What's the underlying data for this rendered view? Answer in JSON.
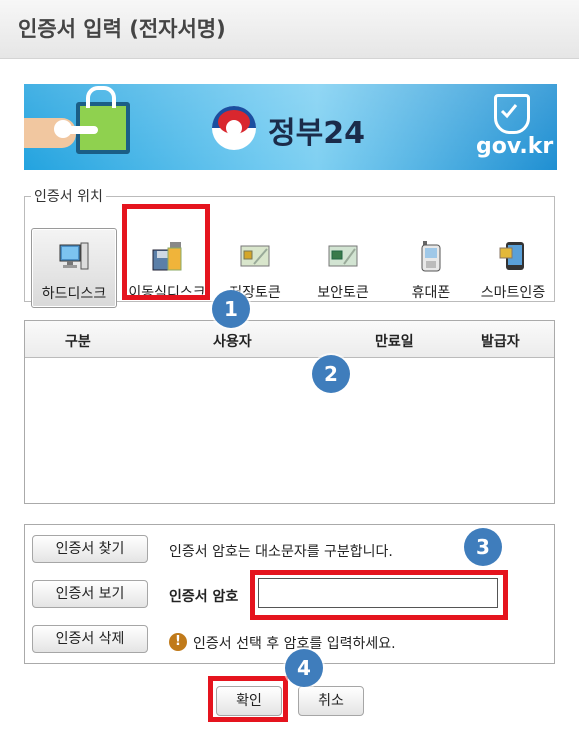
{
  "window": {
    "title": "인증서 입력 (전자서명)"
  },
  "banner": {
    "gov_name": "정부24",
    "domain": "gov.kr"
  },
  "location": {
    "legend": "인증서 위치",
    "devices": [
      {
        "label": "하드디스크",
        "icon": "hard-disk-icon",
        "selected": true
      },
      {
        "label": "이동식디스크",
        "icon": "removable-disk-icon",
        "selected": false
      },
      {
        "label": "저장토큰",
        "icon": "storage-token-icon",
        "selected": false
      },
      {
        "label": "보안토큰",
        "icon": "security-token-icon",
        "selected": false
      },
      {
        "label": "휴대폰",
        "icon": "mobile-phone-icon",
        "selected": false
      },
      {
        "label": "스마트인증",
        "icon": "smart-auth-icon",
        "selected": false
      }
    ]
  },
  "cert_table": {
    "columns": [
      "구분",
      "사용자",
      "만료일",
      "발급자"
    ],
    "rows": []
  },
  "actions": {
    "find_label": "인증서 찾기",
    "view_label": "인증서 보기",
    "delete_label": "인증서 삭제",
    "case_note": "인증서 암호는 대소문자를 구분합니다.",
    "password_label": "인증서 암호",
    "password_value": "",
    "hint": "인증서 선택 후 암호를 입력하세요."
  },
  "footer": {
    "ok_label": "확인",
    "cancel_label": "취소"
  },
  "annotations": {
    "badges": [
      "1",
      "2",
      "3",
      "4"
    ],
    "highlight_color": "#e5141e",
    "badge_color": "#3f7dbc"
  }
}
